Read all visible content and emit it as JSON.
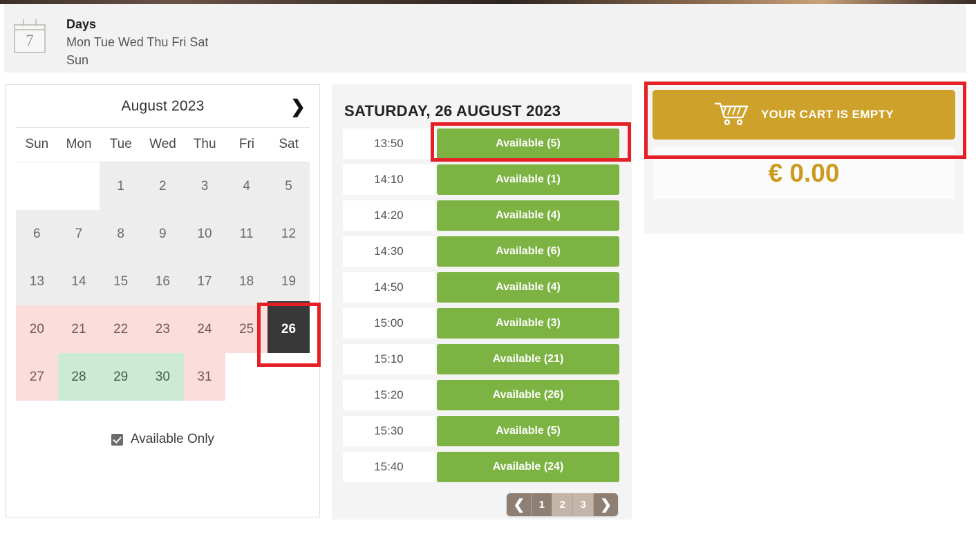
{
  "header": {
    "icon": "calendar-icon",
    "icon_number": "7",
    "title": "Days",
    "days_line1": "Mon Tue Wed Thu Fri Sat",
    "days_line2": "Sun"
  },
  "calendar": {
    "month_label": "August 2023",
    "next_icon": "chevron-right-icon",
    "dow": [
      "Sun",
      "Mon",
      "Tue",
      "Wed",
      "Thu",
      "Fri",
      "Sat"
    ],
    "cells": [
      {
        "label": "",
        "state": "empty"
      },
      {
        "label": "",
        "state": "empty"
      },
      {
        "label": "1",
        "state": "past"
      },
      {
        "label": "2",
        "state": "past"
      },
      {
        "label": "3",
        "state": "past"
      },
      {
        "label": "4",
        "state": "past"
      },
      {
        "label": "5",
        "state": "past"
      },
      {
        "label": "6",
        "state": "past"
      },
      {
        "label": "7",
        "state": "past"
      },
      {
        "label": "8",
        "state": "past"
      },
      {
        "label": "9",
        "state": "past"
      },
      {
        "label": "10",
        "state": "past"
      },
      {
        "label": "11",
        "state": "past"
      },
      {
        "label": "12",
        "state": "past"
      },
      {
        "label": "13",
        "state": "past"
      },
      {
        "label": "14",
        "state": "past"
      },
      {
        "label": "15",
        "state": "past"
      },
      {
        "label": "16",
        "state": "past"
      },
      {
        "label": "17",
        "state": "past"
      },
      {
        "label": "18",
        "state": "past"
      },
      {
        "label": "19",
        "state": "past"
      },
      {
        "label": "20",
        "state": "unavailable"
      },
      {
        "label": "21",
        "state": "unavailable"
      },
      {
        "label": "22",
        "state": "unavailable"
      },
      {
        "label": "23",
        "state": "unavailable"
      },
      {
        "label": "24",
        "state": "unavailable"
      },
      {
        "label": "25",
        "state": "unavailable"
      },
      {
        "label": "26",
        "state": "selected"
      },
      {
        "label": "27",
        "state": "unavailable"
      },
      {
        "label": "28",
        "state": "available"
      },
      {
        "label": "29",
        "state": "available"
      },
      {
        "label": "30",
        "state": "available"
      },
      {
        "label": "31",
        "state": "unavailable"
      },
      {
        "label": "",
        "state": "empty"
      },
      {
        "label": "",
        "state": "empty"
      }
    ],
    "available_only_label": "Available Only",
    "available_only_checked": true
  },
  "slots": {
    "title": "SATURDAY, 26 AUGUST 2023",
    "rows": [
      {
        "time": "13:50",
        "status": "Available (5)"
      },
      {
        "time": "14:10",
        "status": "Available (1)"
      },
      {
        "time": "14:20",
        "status": "Available (4)"
      },
      {
        "time": "14:30",
        "status": "Available (6)"
      },
      {
        "time": "14:50",
        "status": "Available (4)"
      },
      {
        "time": "15:00",
        "status": "Available (3)"
      },
      {
        "time": "15:10",
        "status": "Available (21)"
      },
      {
        "time": "15:20",
        "status": "Available (26)"
      },
      {
        "time": "15:30",
        "status": "Available (5)"
      },
      {
        "time": "15:40",
        "status": "Available (24)"
      }
    ],
    "pagination": {
      "prev_icon": "chevron-left-icon",
      "next_icon": "chevron-right-icon",
      "pages": [
        "1",
        "2",
        "3"
      ],
      "active_page": "1"
    }
  },
  "cart": {
    "icon": "shopping-cart-icon",
    "button_label": "YOUR CART IS EMPTY",
    "total": "€ 0.00"
  },
  "colors": {
    "available_green": "#7cb342",
    "cal_available": "#cdead6",
    "cal_unavailable": "#fbdddb",
    "cal_past": "#ededed",
    "selected_day": "#383838",
    "cart_gold": "#cea12a",
    "total_gold": "#cc9a1f",
    "annotation_red": "#e41f25",
    "pager_active": "#8d7f74",
    "pager_inactive": "#c3b5a8"
  }
}
